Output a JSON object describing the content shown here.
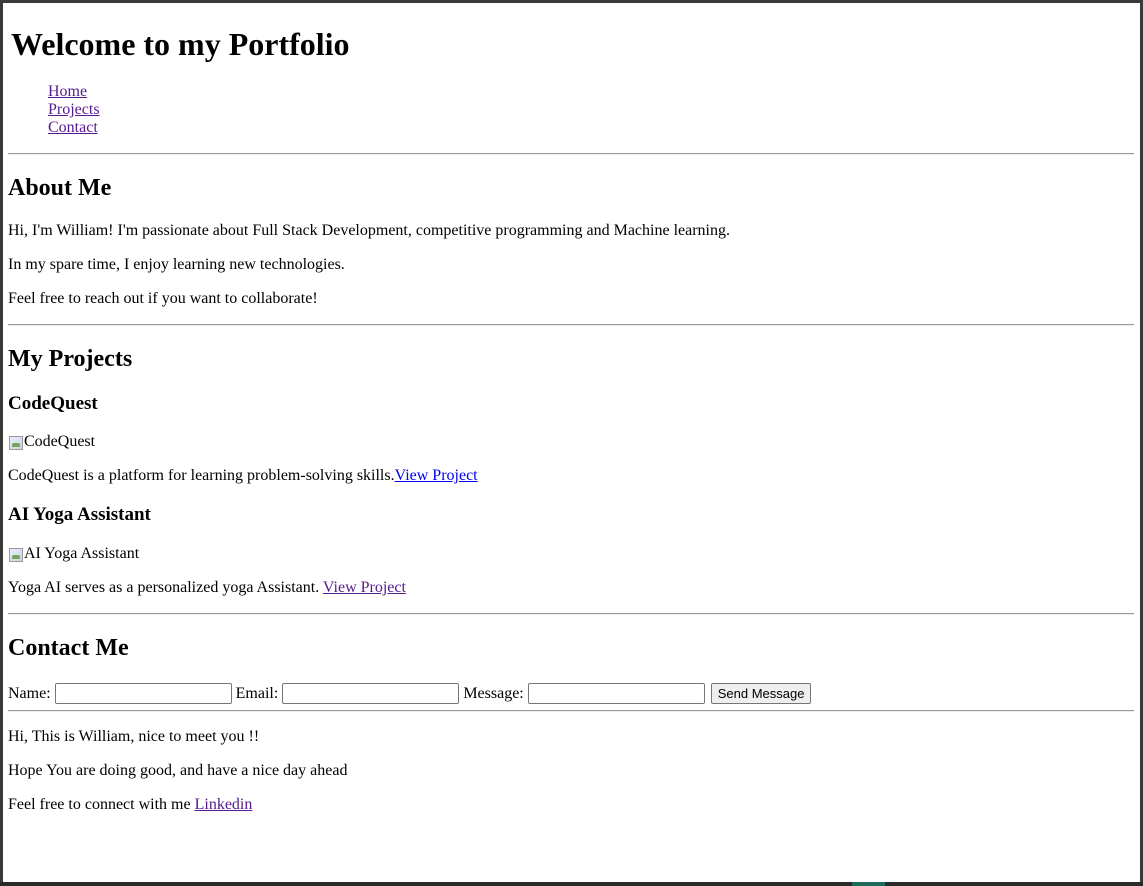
{
  "header": {
    "title": "Welcome to my Portfolio",
    "nav": [
      "Home",
      "Projects",
      "Contact"
    ]
  },
  "about": {
    "heading": "About Me",
    "lines": [
      "Hi, I'm William! I'm passionate about Full Stack Development, competitive programming and Machine learning.",
      "In my spare time, I enjoy learning new technologies.",
      "Feel free to reach out if you want to collaborate!"
    ]
  },
  "projects": {
    "heading": "My Projects",
    "items": [
      {
        "name": "CodeQuest",
        "image_alt": "CodeQuest",
        "description": "CodeQuest is a platform for learning problem-solving skills.",
        "link": "View Project"
      },
      {
        "name": "AI Yoga Assistant",
        "image_alt": "AI Yoga Assistant",
        "description": "Yoga AI serves as a personalized yoga Assistant. ",
        "link": "View Project"
      }
    ]
  },
  "contact": {
    "heading": "Contact Me",
    "name_label": "Name:",
    "email_label": "Email:",
    "message_label": "Message:",
    "name_value": "",
    "email_value": "",
    "message_value": "",
    "send_label": "Send Message"
  },
  "footer": {
    "lines": [
      "Hi, This is William, nice to meet you !!",
      "Hope You are doing good, and have a nice day ahead"
    ],
    "connect_text": "Feel free to connect with me ",
    "linkedin": "Linkedin"
  },
  "colors": {
    "link_visited": "#551a8b",
    "link_unvisited": "#0000ee",
    "divider": "#9a9a9a"
  }
}
